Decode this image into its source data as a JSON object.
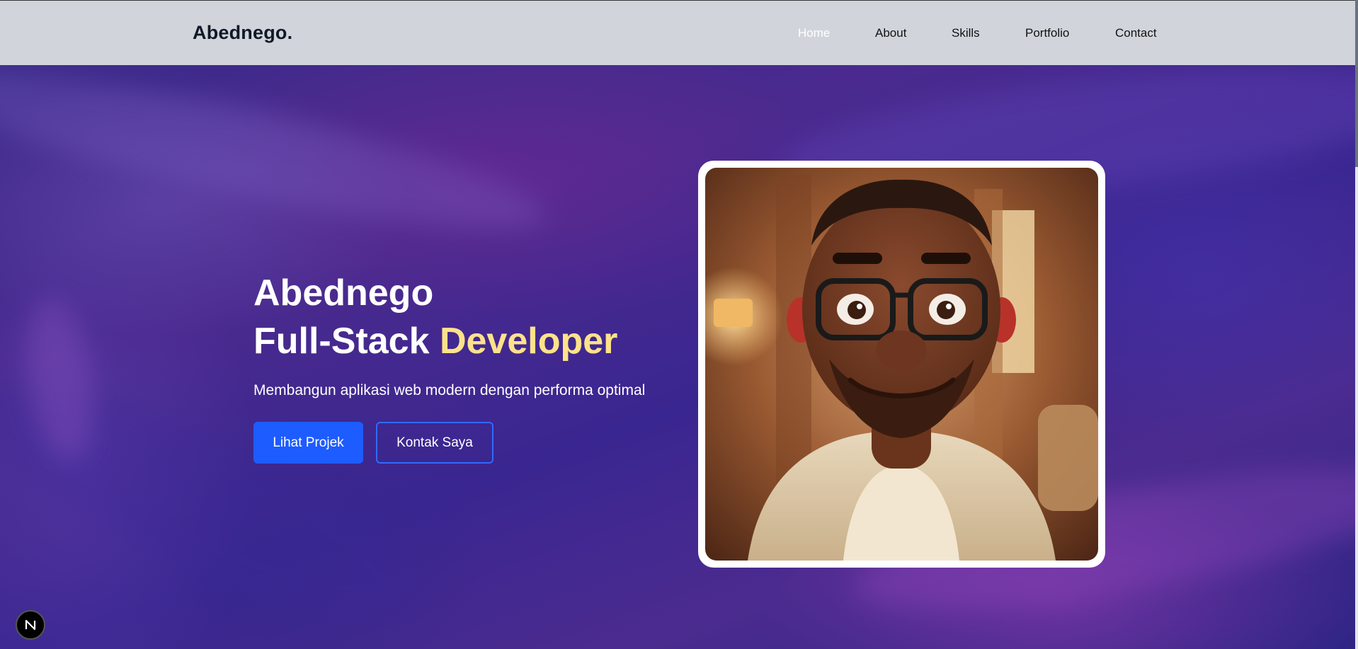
{
  "navbar": {
    "brand": "Abednego.",
    "links": [
      {
        "label": "Home",
        "active": true
      },
      {
        "label": "About",
        "active": false
      },
      {
        "label": "Skills",
        "active": false
      },
      {
        "label": "Portfolio",
        "active": false
      },
      {
        "label": "Contact",
        "active": false
      }
    ]
  },
  "hero": {
    "title_line1": "Abednego",
    "title_line2_prefix": "Full-Stack ",
    "title_line2_highlight": "Developer",
    "subtitle": "Membangun aplikasi web modern dengan performa optimal",
    "primary_button": "Lihat Projek",
    "secondary_button": "Kontak Saya"
  },
  "badge": {
    "icon": "n-logo-icon"
  },
  "colors": {
    "navbar_bg": "#d1d5db",
    "accent_blue": "#1d5cff",
    "highlight_yellow": "#fde28a",
    "hero_purple": "#3b2a8a"
  }
}
